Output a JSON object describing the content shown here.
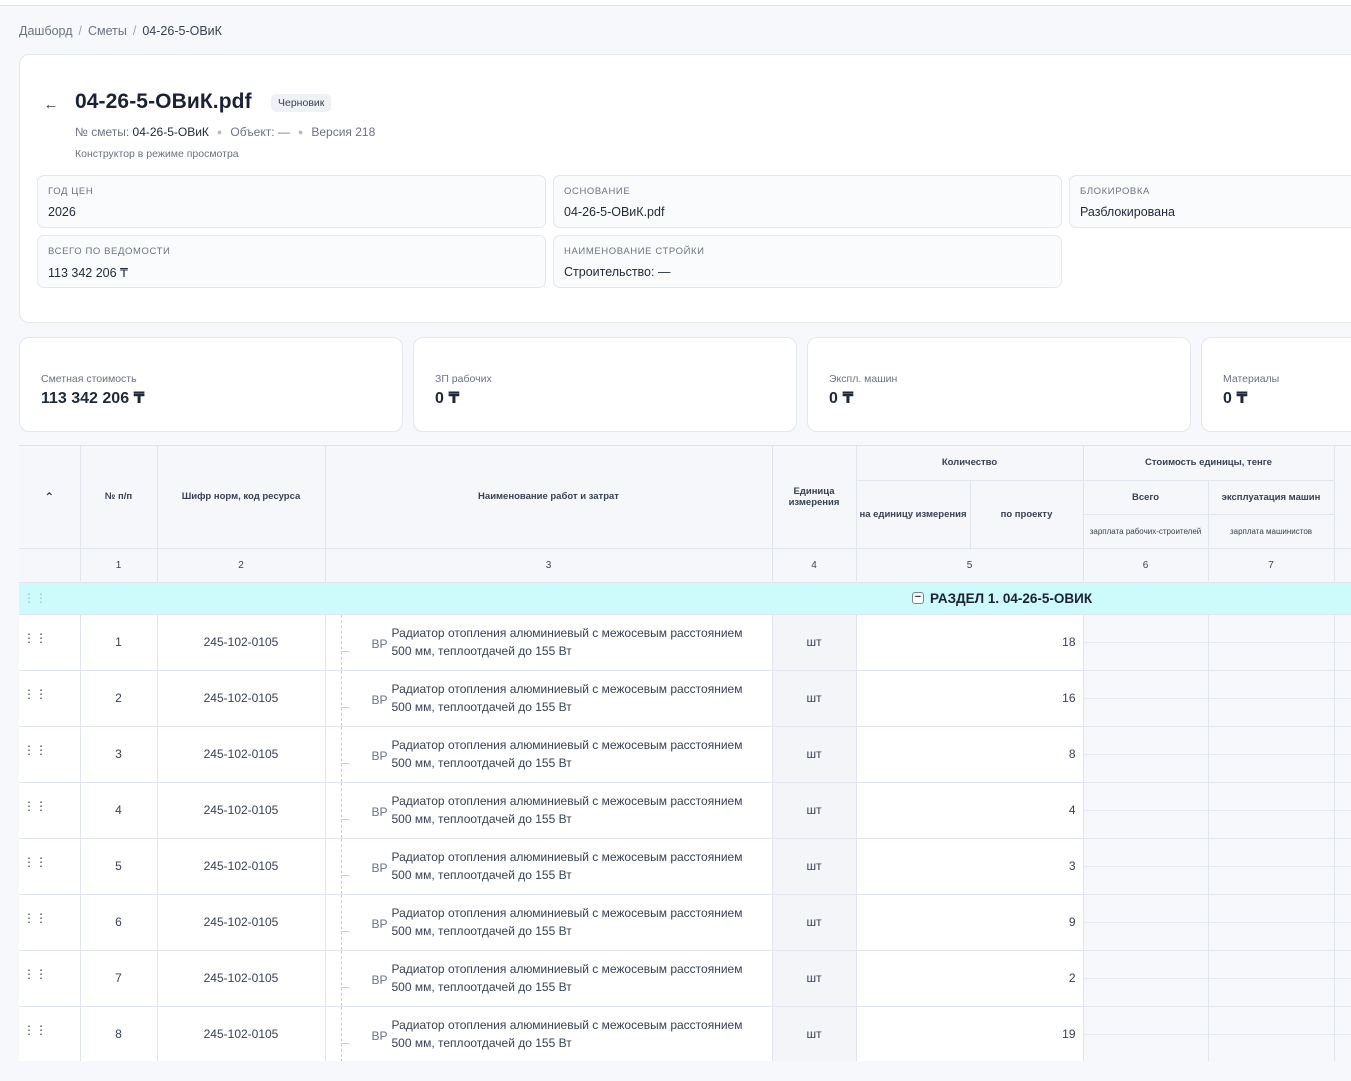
{
  "breadcrumb": {
    "items": [
      "Дашборд",
      "Сметы"
    ],
    "separator": "/",
    "current": "04-26-5-ОВиК"
  },
  "header": {
    "title": "04-26-5-ОВиК.pdf",
    "status_badge": "Черновик",
    "estimate_no_label": "№ сметы:",
    "estimate_no": "04-26-5-ОВиК",
    "object_label": "Объект:",
    "object_value": "—",
    "version": "Версия 218",
    "note": "Конструктор в режиме просмотра"
  },
  "fields": {
    "price_year": {
      "label": "ГОД ЦЕН",
      "value": "2026"
    },
    "basis": {
      "label": "ОСНОВАНИЕ",
      "value": "04-26-5-ОВиК.pdf"
    },
    "lock": {
      "label": "БЛОКИРОВКА",
      "value": "Разблокирована"
    },
    "total": {
      "label": "ВСЕГО ПО ВЕДОМОСТИ",
      "value": "113 342 206 ₸"
    },
    "construction": {
      "label": "НАИМЕНОВАНИЕ СТРОЙКИ",
      "value": "Строительство: —"
    }
  },
  "stats": [
    {
      "label": "Сметная стоимость",
      "value": "113 342 206 ₸"
    },
    {
      "label": "ЗП рабочих",
      "value": "0 ₸"
    },
    {
      "label": "Экспл. машин",
      "value": "0 ₸"
    },
    {
      "label": "Материалы",
      "value": "0 ₸"
    }
  ],
  "table": {
    "headers": {
      "num": "№ п/п",
      "code": "Шифр норм, код ресурса",
      "name": "Наименование работ и затрат",
      "unit": "Единица измерения",
      "quantity": "Количество",
      "qty_per_unit": "на единицу измерения",
      "qty_project": "по проекту",
      "unit_cost": "Стоимость единицы, тенге",
      "cost_total": "Всего",
      "cost_machines": "эксплуатация машин",
      "cost_labor": "зарплата рабочих-строителей",
      "cost_operators": "зарплата машинистов"
    },
    "col_numbers": [
      "1",
      "2",
      "3",
      "4",
      "5",
      "6",
      "7"
    ],
    "section_title": "РАЗДЕЛ 1. 04-26-5-ОВИК",
    "rows": [
      {
        "n": "1",
        "code": "245-102-0105",
        "tag": "ВР",
        "name": "Радиатор отопления алюминиевый с межосевым расстоянием 500 мм, теплоотдачей до 155 Вт",
        "unit": "шт",
        "qty": "18"
      },
      {
        "n": "2",
        "code": "245-102-0105",
        "tag": "ВР",
        "name": "Радиатор отопления алюминиевый с межосевым расстоянием 500 мм, теплоотдачей до 155 Вт",
        "unit": "шт",
        "qty": "16"
      },
      {
        "n": "3",
        "code": "245-102-0105",
        "tag": "ВР",
        "name": "Радиатор отопления алюминиевый с межосевым расстоянием 500 мм, теплоотдачей до 155 Вт",
        "unit": "шт",
        "qty": "8"
      },
      {
        "n": "4",
        "code": "245-102-0105",
        "tag": "ВР",
        "name": "Радиатор отопления алюминиевый с межосевым расстоянием 500 мм, теплоотдачей до 155 Вт",
        "unit": "шт",
        "qty": "4"
      },
      {
        "n": "5",
        "code": "245-102-0105",
        "tag": "ВР",
        "name": "Радиатор отопления алюминиевый с межосевым расстоянием 500 мм, теплоотдачей до 155 Вт",
        "unit": "шт",
        "qty": "3"
      },
      {
        "n": "6",
        "code": "245-102-0105",
        "tag": "ВР",
        "name": "Радиатор отопления алюминиевый с межосевым расстоянием 500 мм, теплоотдачей до 155 Вт",
        "unit": "шт",
        "qty": "9"
      },
      {
        "n": "7",
        "code": "245-102-0105",
        "tag": "ВР",
        "name": "Радиатор отопления алюминиевый с межосевым расстоянием 500 мм, теплоотдачей до 155 Вт",
        "unit": "шт",
        "qty": "2"
      },
      {
        "n": "8",
        "code": "245-102-0105",
        "tag": "ВР",
        "name": "Радиатор отопления алюминиевый с межосевым расстоянием 500 мм, теплоотдачей до 155 Вт",
        "unit": "шт",
        "qty": "19"
      }
    ]
  }
}
